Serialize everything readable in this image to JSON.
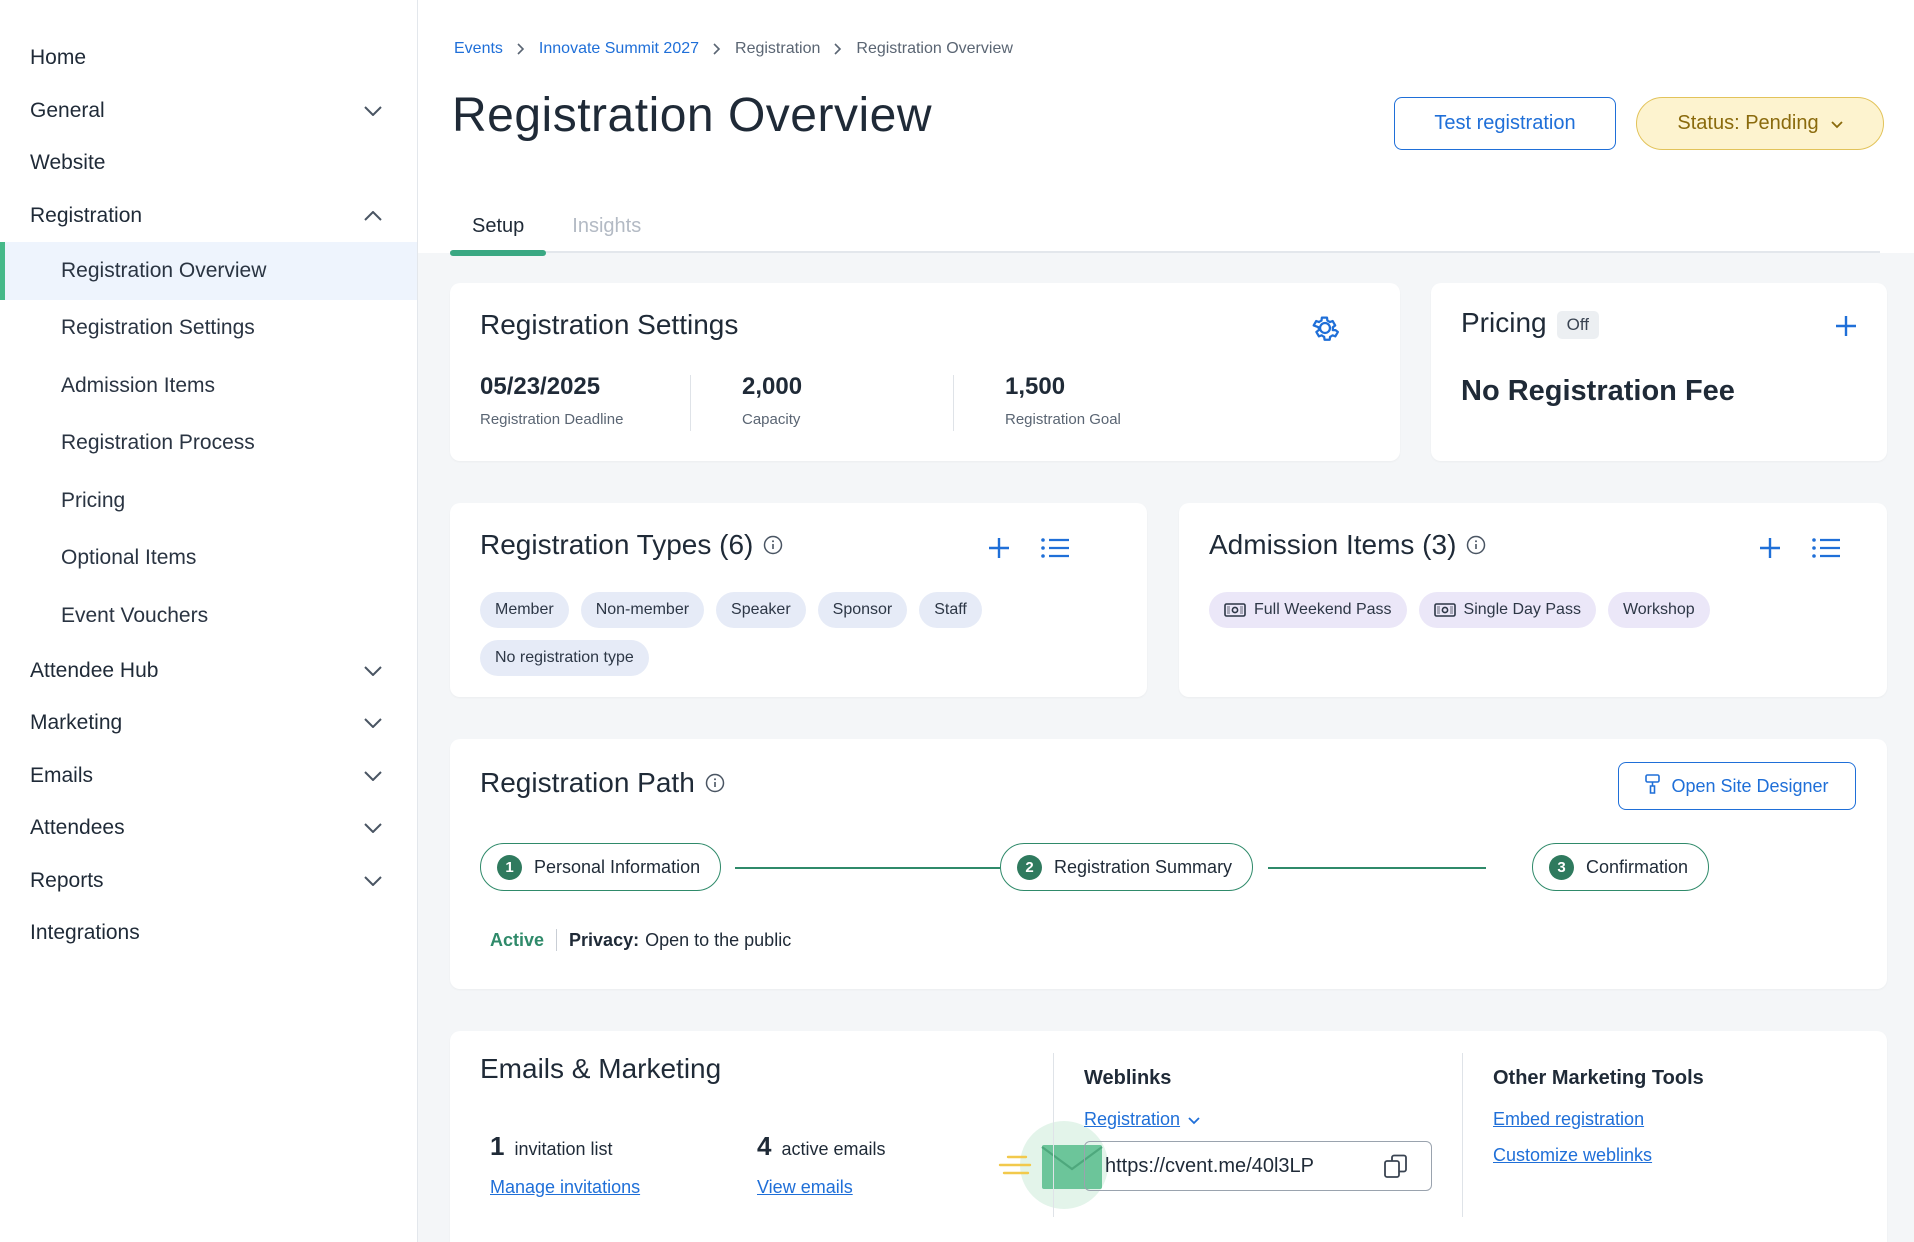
{
  "sidebar": {
    "home": "Home",
    "general": "General",
    "website": "Website",
    "registration": "Registration",
    "sub_items": [
      "Registration Overview",
      "Registration Settings",
      "Admission Items",
      "Registration Process",
      "Pricing",
      "Optional Items",
      "Event Vouchers"
    ],
    "attendee_hub": "Attendee Hub",
    "marketing": "Marketing",
    "emails": "Emails",
    "attendees": "Attendees",
    "reports": "Reports",
    "integrations": "Integrations"
  },
  "breadcrumb": {
    "events": "Events",
    "event": "Innovate Summit 2027",
    "registration": "Registration",
    "current": "Registration Overview"
  },
  "header": {
    "title": "Registration Overview",
    "test_button": "Test registration",
    "status": "Status: Pending"
  },
  "tabs": {
    "setup": "Setup",
    "insights": "Insights"
  },
  "settings": {
    "title": "Registration Settings",
    "deadline_value": "05/23/2025",
    "deadline_label": "Registration Deadline",
    "capacity_value": "2,000",
    "capacity_label": "Capacity",
    "goal_value": "1,500",
    "goal_label": "Registration Goal"
  },
  "pricing": {
    "title": "Pricing",
    "badge": "Off",
    "fee_text": "No Registration Fee"
  },
  "types": {
    "title": "Registration Types (6)",
    "chips": [
      "Member",
      "Non-member",
      "Speaker",
      "Sponsor",
      "Staff",
      "No registration type"
    ]
  },
  "admission": {
    "title": "Admission Items (3)",
    "chips": [
      "Full Weekend Pass",
      "Single Day Pass",
      "Workshop"
    ]
  },
  "path": {
    "title": "Registration Path",
    "designer_button": "Open Site Designer",
    "steps": [
      {
        "num": "1",
        "label": "Personal Information"
      },
      {
        "num": "2",
        "label": "Registration Summary"
      },
      {
        "num": "3",
        "label": "Confirmation"
      }
    ],
    "status": "Active",
    "privacy_label": "Privacy:",
    "privacy_value": "Open to the public"
  },
  "emails": {
    "title": "Emails & Marketing",
    "invite_count": "1",
    "invite_label": "invitation list",
    "invite_link": "Manage invitations",
    "active_count": "4",
    "active_label": "active emails",
    "active_link": "View emails",
    "weblinks_title": "Weblinks",
    "weblink_select": "Registration",
    "weblink_url": "https://cvent.me/40l3LP",
    "tools_title": "Other Marketing Tools",
    "tool_embed": "Embed registration",
    "tool_customize": "Customize weblinks"
  },
  "colors": {
    "accent": "#1f6fd8",
    "active_green": "#2f8a6a",
    "status_bg": "#fdf3cf",
    "status_text": "#8a6a0c"
  }
}
